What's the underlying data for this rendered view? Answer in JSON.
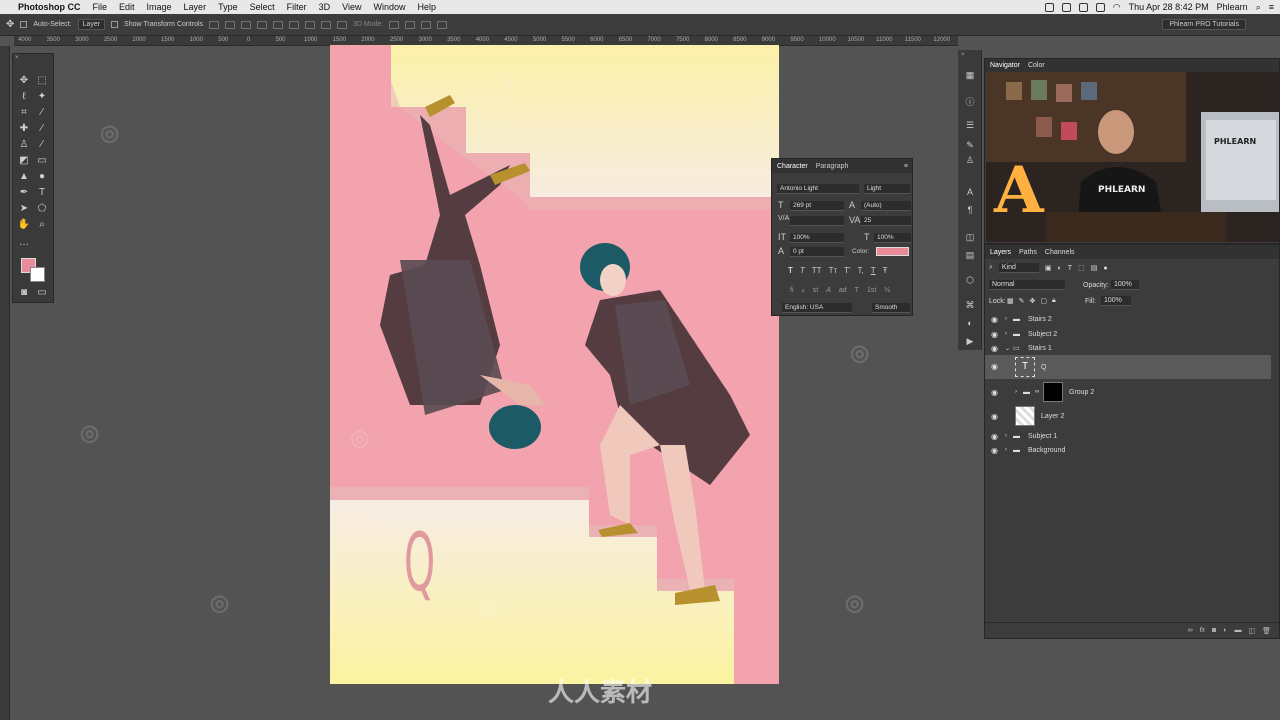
{
  "menubar": {
    "app": "Photoshop CC",
    "items": [
      "File",
      "Edit",
      "Image",
      "Layer",
      "Type",
      "Select",
      "Filter",
      "3D",
      "View",
      "Window",
      "Help"
    ],
    "datetime": "Thu Apr 28  8:42 PM",
    "user": "Phlearn"
  },
  "options": {
    "auto_select_label": "Auto-Select:",
    "auto_select_value": "Layer",
    "show_transform": "Show Transform Controls",
    "mode_3d": "3D Mode:",
    "workspace": "Phlearn PRO Tutorials"
  },
  "ruler": {
    "ticks": [
      "4000",
      "3500",
      "3000",
      "2500",
      "2000",
      "1500",
      "1000",
      "500",
      "0",
      "500",
      "1000",
      "1500",
      "2000",
      "2500",
      "3000",
      "3500",
      "4000",
      "4500",
      "5000",
      "5500",
      "6000",
      "6500",
      "7000",
      "7500",
      "8000",
      "8500",
      "9000",
      "9500",
      "10000",
      "10500",
      "11000",
      "11500",
      "12000"
    ]
  },
  "canvas": {
    "letter": "Q",
    "watermark_text": "人人素材"
  },
  "character": {
    "tabs": [
      "Character",
      "Paragraph"
    ],
    "font_family": "Antonio Light",
    "font_style": "Light",
    "size": "269 pt",
    "leading": "(Auto)",
    "kerning": "V/A",
    "tracking": "25",
    "vscale": "100%",
    "hscale": "100%",
    "baseline": "0 pt",
    "color_label": "Color:",
    "color": "#e98c9a",
    "language": "English: USA",
    "antialias": "Smooth",
    "style_buttons": [
      "T",
      "T",
      "TT",
      "Tт",
      "T'",
      "T,",
      "T",
      "Ŧ"
    ],
    "open_buttons": [
      "fi",
      "ℴ",
      "st",
      "A",
      "ad",
      "T",
      "1st",
      "½"
    ]
  },
  "navigator": {
    "tabs": [
      "Navigator",
      "Color"
    ]
  },
  "layers": {
    "tabs": [
      "Layers",
      "Paths",
      "Channels"
    ],
    "filter": "Kind",
    "blend_mode": "Normal",
    "opacity_label": "Opacity:",
    "opacity": "100%",
    "lock_label": "Lock:",
    "fill_label": "Fill:",
    "fill": "100%",
    "rows": [
      {
        "name": "Stairs 2",
        "type": "group"
      },
      {
        "name": "Subject 2",
        "type": "group"
      },
      {
        "name": "Stairs 1",
        "type": "group-open"
      },
      {
        "name": "Q",
        "type": "text"
      },
      {
        "name": "Group 2",
        "type": "group-mask"
      },
      {
        "name": "Layer 2",
        "type": "pixel"
      },
      {
        "name": "Subject 1",
        "type": "group"
      },
      {
        "name": "Background",
        "type": "group"
      }
    ],
    "bottom_icons": [
      "link-icon",
      "fx-icon",
      "mask-icon",
      "adjustment-icon",
      "folder-icon",
      "new-layer-icon",
      "trash-icon"
    ],
    "bottom_fx": "fx"
  }
}
